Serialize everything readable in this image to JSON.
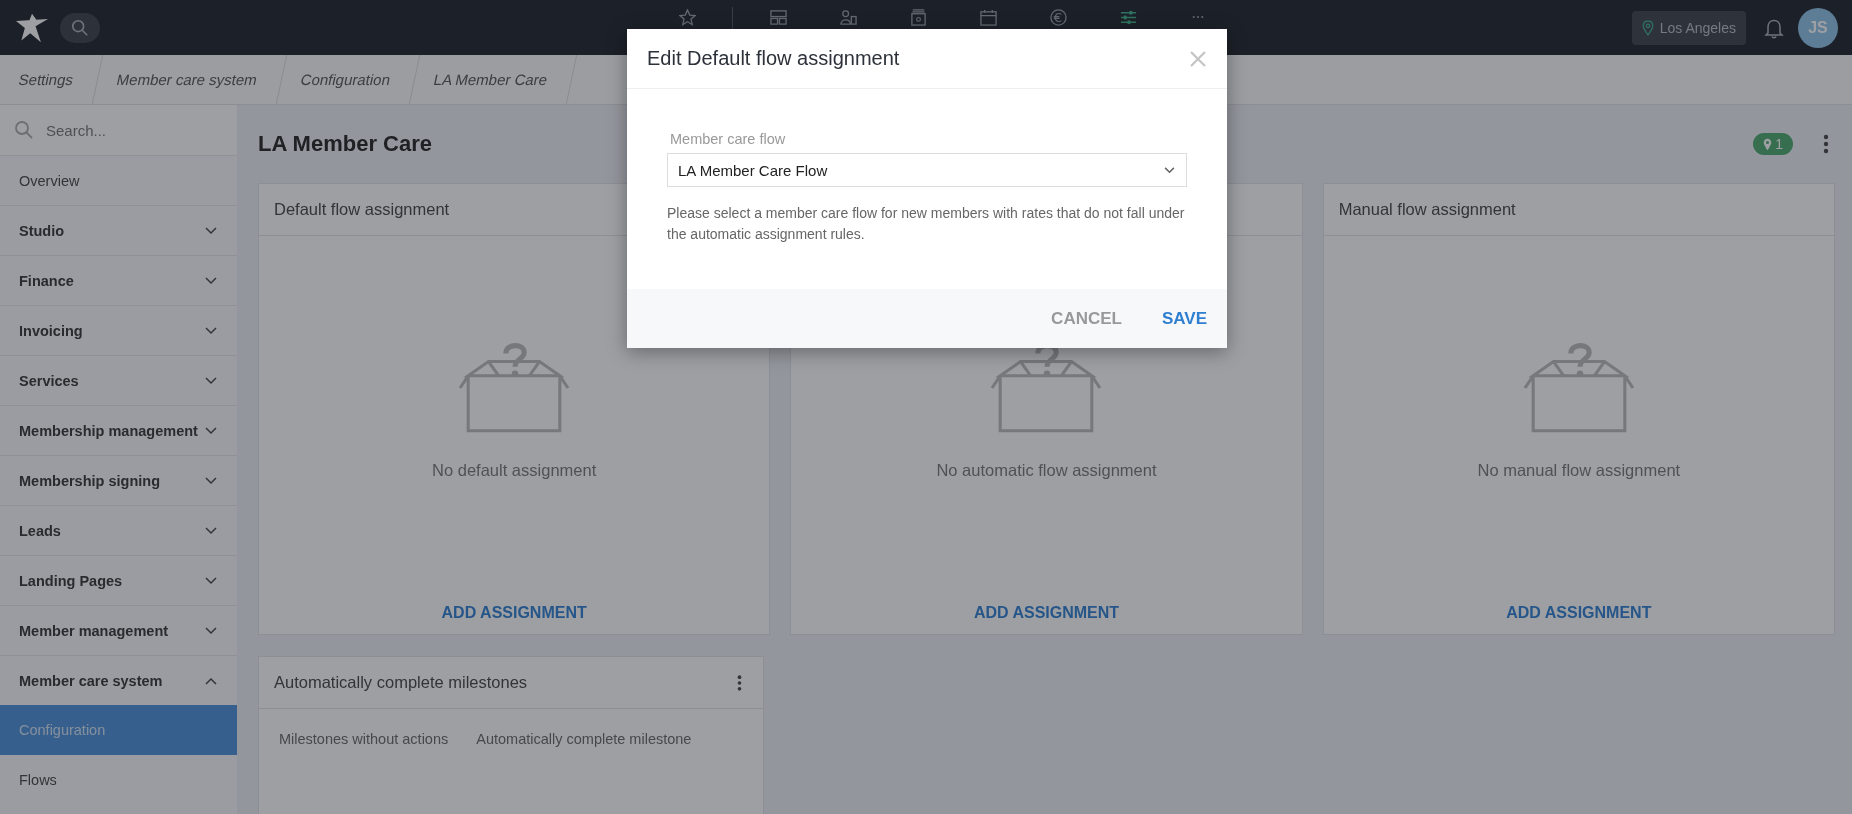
{
  "topbar": {
    "nav": [
      {
        "kind": "star",
        "selected": false
      },
      {
        "kind": "layout",
        "selected": false
      },
      {
        "kind": "person-card",
        "selected": false
      },
      {
        "kind": "register",
        "selected": false
      },
      {
        "kind": "calendar",
        "selected": false
      },
      {
        "kind": "euro",
        "selected": false
      },
      {
        "kind": "sliders",
        "selected": true
      },
      {
        "kind": "more",
        "selected": false
      }
    ],
    "location": "Los Angeles",
    "avatar_initials": "JS"
  },
  "breadcrumbs": [
    "Settings",
    "Member care system",
    "Configuration",
    "LA Member Care"
  ],
  "sidebar": {
    "search": {
      "placeholder": "Search..."
    },
    "items": [
      {
        "kind": "link",
        "label": "Overview",
        "selected": false
      },
      {
        "kind": "group",
        "label": "Studio",
        "expanded": false
      },
      {
        "kind": "group",
        "label": "Finance",
        "expanded": false
      },
      {
        "kind": "group",
        "label": "Invoicing",
        "expanded": false
      },
      {
        "kind": "group",
        "label": "Services",
        "expanded": false
      },
      {
        "kind": "group",
        "label": "Membership management",
        "expanded": false
      },
      {
        "kind": "group",
        "label": "Membership signing",
        "expanded": false
      },
      {
        "kind": "group",
        "label": "Leads",
        "expanded": false
      },
      {
        "kind": "group",
        "label": "Landing Pages",
        "expanded": false
      },
      {
        "kind": "group",
        "label": "Member management",
        "expanded": false
      },
      {
        "kind": "group",
        "label": "Member care system",
        "expanded": true,
        "children": [
          {
            "label": "Configuration",
            "selected": true
          },
          {
            "label": "Flows",
            "selected": false
          }
        ]
      }
    ]
  },
  "page": {
    "title": "LA Member Care",
    "location_badge": "1",
    "cards": [
      {
        "title": "Default flow assignment",
        "empty_text": "No default assignment",
        "action": "ADD ASSIGNMENT"
      },
      {
        "empty_text": "No automatic flow assignment",
        "action": "ADD ASSIGNMENT"
      },
      {
        "title": "Manual flow assignment",
        "empty_text": "No manual flow assignment",
        "action": "ADD ASSIGNMENT"
      }
    ],
    "milestones": {
      "title": "Automatically complete milestones",
      "columns": [
        "Milestones without actions",
        "Automatically complete milestone"
      ]
    }
  },
  "modal": {
    "title": "Edit Default flow assignment",
    "field": {
      "label": "Member care flow",
      "value": "LA Member Care Flow"
    },
    "help": "Please select a member care flow for new members with rates that do not fall under the automatic assignment rules.",
    "buttons": {
      "cancel": "CANCEL",
      "save": "SAVE"
    }
  }
}
